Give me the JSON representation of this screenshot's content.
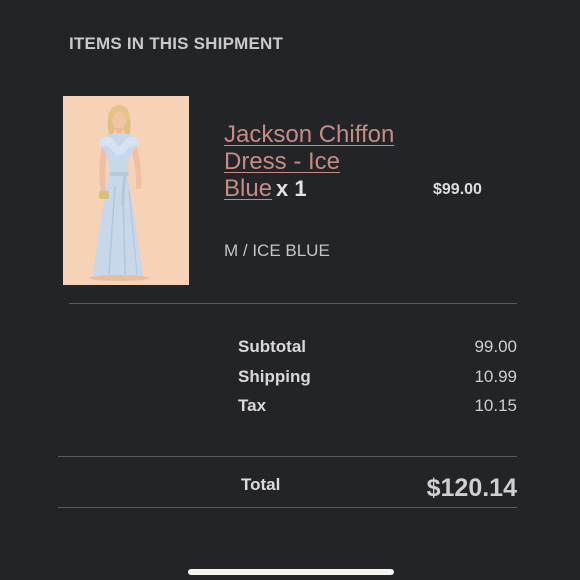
{
  "shipment": {
    "title": "ITEMS IN THIS SHIPMENT"
  },
  "item": {
    "name": "Jackson Chiffon Dress - Ice Blue",
    "quantity": "x 1",
    "variant": "M / ICE BLUE",
    "price": "$99.00",
    "image_icon": "product-photo-dress"
  },
  "summary": {
    "subtotal_label": "Subtotal",
    "subtotal_value": "99.00",
    "shipping_label": "Shipping",
    "shipping_value": "10.99",
    "tax_label": "Tax",
    "tax_value": "10.15",
    "total_label": "Total",
    "total_value": "$120.14"
  },
  "colors": {
    "background": "#232427",
    "link": "#c48c84",
    "divider": "#5a5b5f"
  }
}
